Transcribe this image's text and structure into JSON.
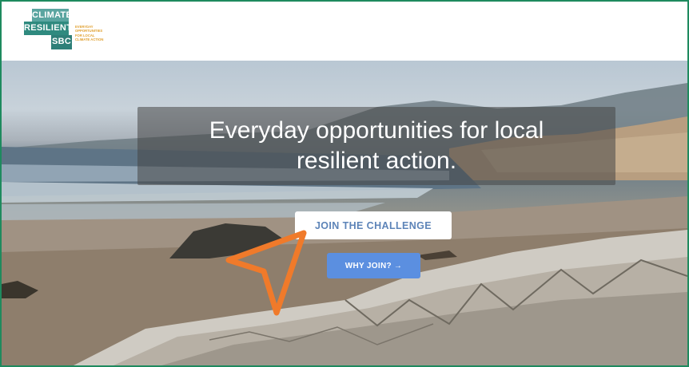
{
  "header": {
    "logo": {
      "line1": "CLIMATE",
      "line2": "RESILIENT",
      "line3": "SBC",
      "tagline": "EVERYDAY\nOPPORTUNITIES\nFOR LOCAL\nCLIMATE ACTION"
    }
  },
  "hero": {
    "headline": "Everyday opportunities for local resilient action.",
    "primary_button": "JOIN THE CHALLENGE",
    "secondary_button": "WHY JOIN?",
    "secondary_button_icon": "arrow-right-icon"
  },
  "colors": {
    "frame_border": "#1e8a5e",
    "logo_teal": "#2f8a7f",
    "primary_button_text": "#5d84b8",
    "secondary_button_bg": "#5b8fe0",
    "cursor": "#f07a2a"
  }
}
